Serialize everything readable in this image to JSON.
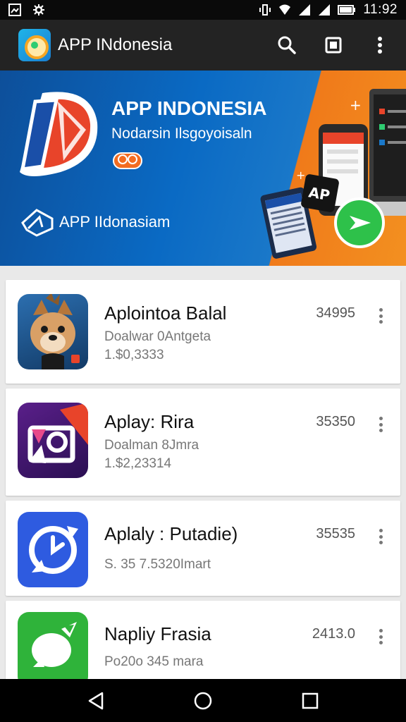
{
  "status_bar": {
    "time": "11:92"
  },
  "toolbar": {
    "title": "APP INdonesia"
  },
  "banner": {
    "title": "APP INDONESIA",
    "subtitle": "Nodarsin Ilsgoyoisaln",
    "brand": "APP IIdonasiam",
    "device_badge": "AP"
  },
  "apps": [
    {
      "title": "Aplointoa Balal",
      "line1": "Doalwar 0Antgeta",
      "line2": "1.$0,3333",
      "count": "34995",
      "icon": "dog-mascot-icon"
    },
    {
      "title": "Aplay: Rira",
      "line1": "Doalman 8Jmra",
      "line2": "1.$2,23314",
      "count": "35350",
      "icon": "photo-frame-icon"
    },
    {
      "title": "Aplaly : Putadie)",
      "line1": "S. 35 7.5320Imart",
      "line2": "",
      "count": "35535",
      "icon": "clock-refresh-icon"
    },
    {
      "title": "Napliy Frasia",
      "line1": "Po20o 345 mara",
      "line2": "",
      "count": "2413.0",
      "icon": "green-bubble-icon"
    }
  ]
}
